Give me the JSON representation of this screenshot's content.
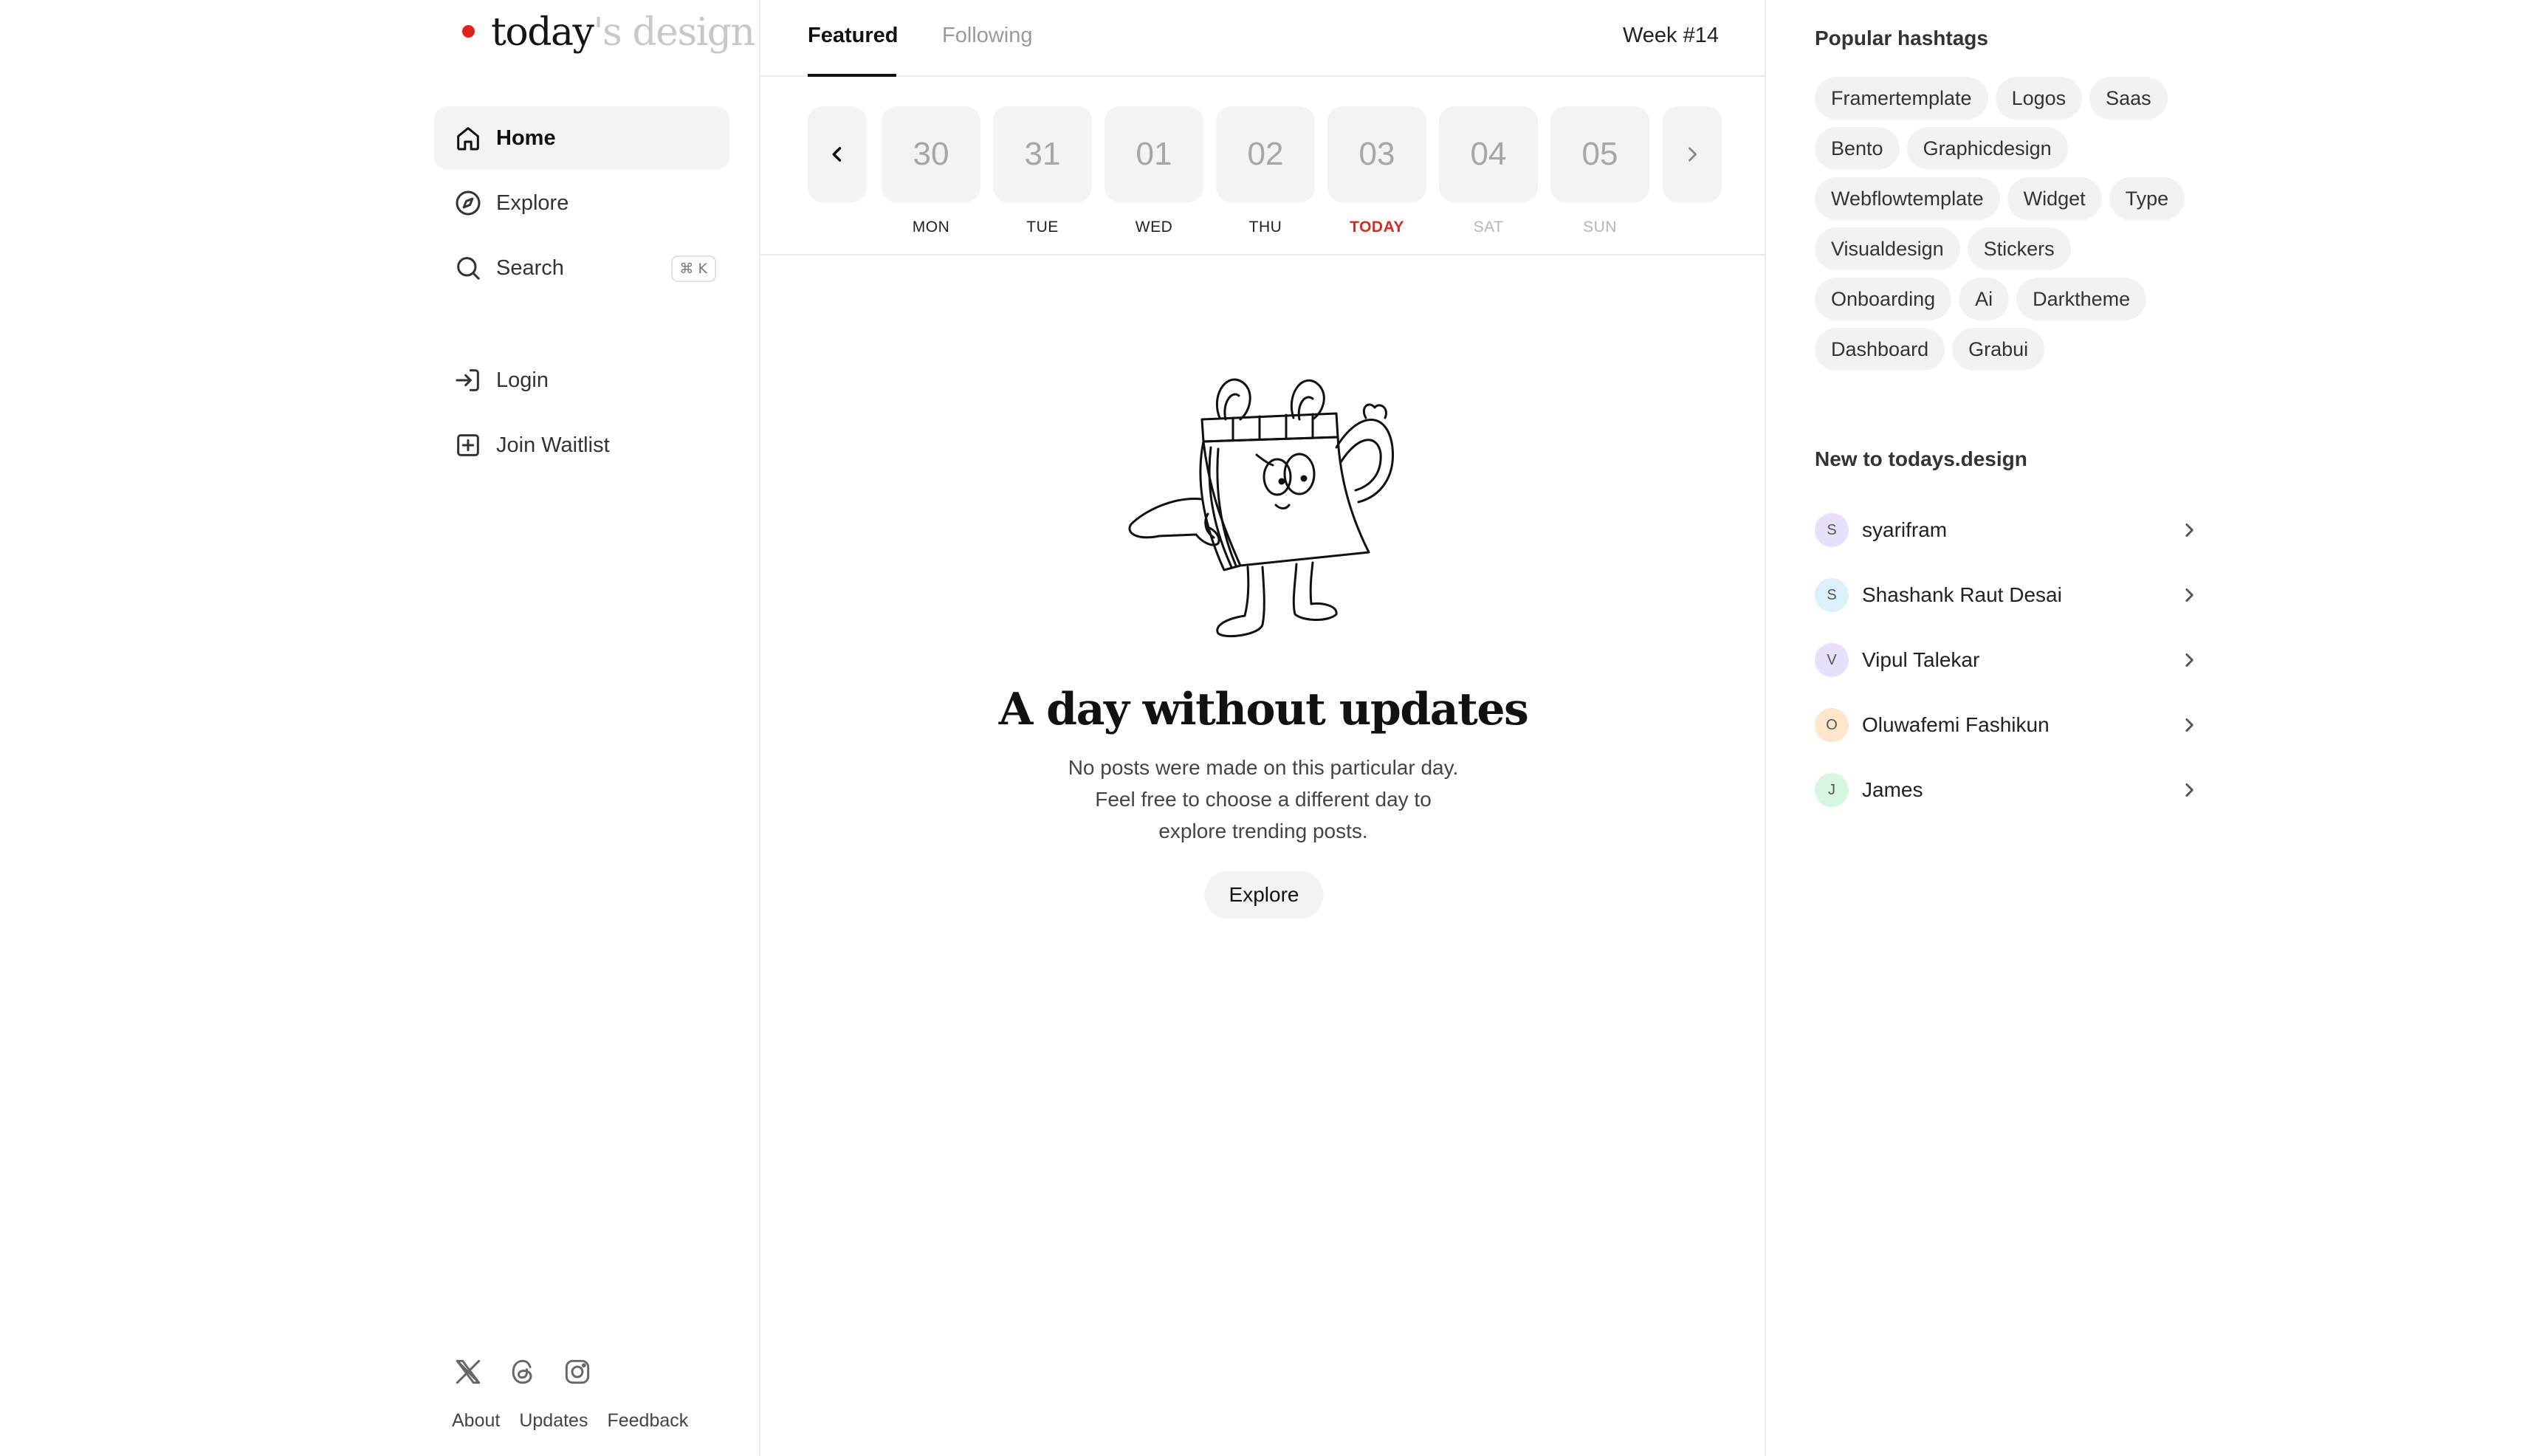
{
  "logo": {
    "part1": "today",
    "part2": "'s design",
    "accent_color": "#e0241b"
  },
  "nav": {
    "home": "Home",
    "explore": "Explore",
    "search": "Search",
    "search_shortcut": "⌘ K",
    "login": "Login",
    "join_waitlist": "Join Waitlist"
  },
  "footer": {
    "links": [
      "About",
      "Updates",
      "Feedback"
    ],
    "social_icons": [
      "x-icon",
      "threads-icon",
      "instagram-icon"
    ]
  },
  "tabs": {
    "featured": "Featured",
    "following": "Following",
    "week": "Week #14"
  },
  "days": [
    {
      "num": "30",
      "label": "MON",
      "state": "normal"
    },
    {
      "num": "31",
      "label": "TUE",
      "state": "normal"
    },
    {
      "num": "01",
      "label": "WED",
      "state": "normal"
    },
    {
      "num": "02",
      "label": "THU",
      "state": "normal"
    },
    {
      "num": "03",
      "label": "TODAY",
      "state": "today"
    },
    {
      "num": "04",
      "label": "SAT",
      "state": "dim"
    },
    {
      "num": "05",
      "label": "SUN",
      "state": "dim"
    }
  ],
  "empty": {
    "title": "A day without updates",
    "line1": "No posts were made on this particular day.",
    "line2": "Feel free to choose a different day to",
    "line3": "explore trending posts.",
    "button": "Explore"
  },
  "hashtags": {
    "title": "Popular hashtags",
    "items": [
      "Framertemplate",
      "Logos",
      "Saas",
      "Bento",
      "Graphicdesign",
      "Webflowtemplate",
      "Widget",
      "Type",
      "Visualdesign",
      "Stickers",
      "Onboarding",
      "Ai",
      "Darktheme",
      "Dashboard",
      "Grabui"
    ]
  },
  "new_users": {
    "title": "New to todays.design",
    "items": [
      {
        "initial": "S",
        "name": "syarifram",
        "color": "#e6e0fa"
      },
      {
        "initial": "S",
        "name": "Shashank Raut Desai",
        "color": "#dcf1fb"
      },
      {
        "initial": "V",
        "name": "Vipul Talekar",
        "color": "#e6e0fa"
      },
      {
        "initial": "O",
        "name": "Oluwafemi Fashikun",
        "color": "#fde6cc"
      },
      {
        "initial": "J",
        "name": "James",
        "color": "#d8f5df"
      }
    ]
  }
}
